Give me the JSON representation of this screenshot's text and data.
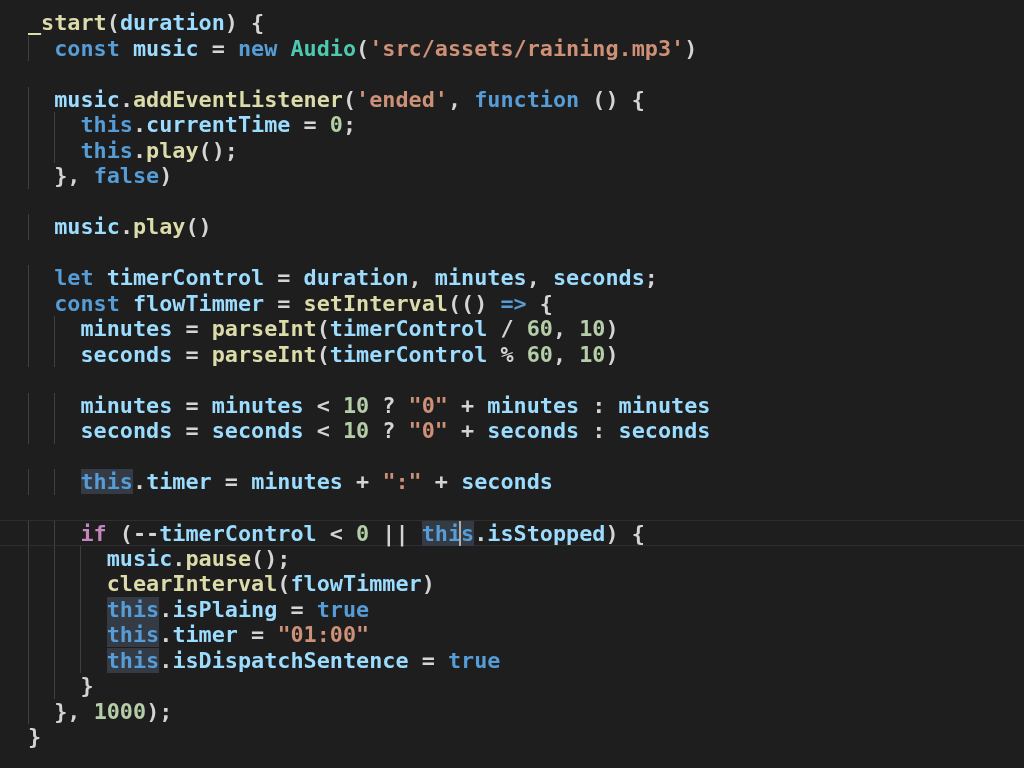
{
  "editor": {
    "lines": [
      {
        "kind": "code",
        "tokens": [
          {
            "text": "_start",
            "kind": "function"
          },
          {
            "text": "(",
            "kind": "punct"
          },
          {
            "text": "duration",
            "kind": "variable"
          },
          {
            "text": ") {",
            "kind": "punct"
          }
        ]
      },
      {
        "kind": "code",
        "tokens": [
          {
            "text": "  const ",
            "kind": "keyword"
          },
          {
            "text": "music",
            "kind": "variable"
          },
          {
            "text": " = ",
            "kind": "punct"
          },
          {
            "text": "new ",
            "kind": "keyword"
          },
          {
            "text": "Audio",
            "kind": "class"
          },
          {
            "text": "(",
            "kind": "punct"
          },
          {
            "text": "'src/assets/raining.mp3'",
            "kind": "string"
          },
          {
            "text": ")",
            "kind": "punct"
          }
        ]
      },
      {
        "kind": "blank"
      },
      {
        "kind": "code",
        "tokens": [
          {
            "text": "  music",
            "kind": "variable"
          },
          {
            "text": ".",
            "kind": "punct"
          },
          {
            "text": "addEventListener",
            "kind": "function"
          },
          {
            "text": "(",
            "kind": "punct"
          },
          {
            "text": "'ended'",
            "kind": "string"
          },
          {
            "text": ", ",
            "kind": "punct"
          },
          {
            "text": "function",
            "kind": "keyword"
          },
          {
            "text": " () {",
            "kind": "punct"
          }
        ]
      },
      {
        "kind": "code",
        "tokens": [
          {
            "text": "    this",
            "kind": "keyword"
          },
          {
            "text": ".",
            "kind": "punct"
          },
          {
            "text": "currentTime",
            "kind": "variable"
          },
          {
            "text": " = ",
            "kind": "punct"
          },
          {
            "text": "0",
            "kind": "number"
          },
          {
            "text": ";",
            "kind": "punct"
          }
        ]
      },
      {
        "kind": "code",
        "tokens": [
          {
            "text": "    this",
            "kind": "keyword"
          },
          {
            "text": ".",
            "kind": "punct"
          },
          {
            "text": "play",
            "kind": "function"
          },
          {
            "text": "();",
            "kind": "punct"
          }
        ]
      },
      {
        "kind": "code",
        "tokens": [
          {
            "text": "  }, ",
            "kind": "punct"
          },
          {
            "text": "false",
            "kind": "keyword"
          },
          {
            "text": ")",
            "kind": "punct"
          }
        ]
      },
      {
        "kind": "blank"
      },
      {
        "kind": "code",
        "tokens": [
          {
            "text": "  music",
            "kind": "variable"
          },
          {
            "text": ".",
            "kind": "punct"
          },
          {
            "text": "play",
            "kind": "function"
          },
          {
            "text": "()",
            "kind": "punct"
          }
        ]
      },
      {
        "kind": "blank"
      },
      {
        "kind": "code",
        "tokens": [
          {
            "text": "  let ",
            "kind": "keyword"
          },
          {
            "text": "timerControl",
            "kind": "variable"
          },
          {
            "text": " = ",
            "kind": "punct"
          },
          {
            "text": "duration",
            "kind": "variable"
          },
          {
            "text": ", ",
            "kind": "punct"
          },
          {
            "text": "minutes",
            "kind": "variable"
          },
          {
            "text": ", ",
            "kind": "punct"
          },
          {
            "text": "seconds",
            "kind": "variable"
          },
          {
            "text": ";",
            "kind": "punct"
          }
        ]
      },
      {
        "kind": "code",
        "tokens": [
          {
            "text": "  const ",
            "kind": "keyword"
          },
          {
            "text": "flowTimmer",
            "kind": "variable"
          },
          {
            "text": " = ",
            "kind": "punct"
          },
          {
            "text": "setInterval",
            "kind": "function"
          },
          {
            "text": "(() ",
            "kind": "punct"
          },
          {
            "text": "=>",
            "kind": "keyword"
          },
          {
            "text": " {",
            "kind": "punct"
          }
        ]
      },
      {
        "kind": "code",
        "tokens": [
          {
            "text": "    minutes",
            "kind": "variable"
          },
          {
            "text": " = ",
            "kind": "punct"
          },
          {
            "text": "parseInt",
            "kind": "function"
          },
          {
            "text": "(",
            "kind": "punct"
          },
          {
            "text": "timerControl",
            "kind": "variable"
          },
          {
            "text": " / ",
            "kind": "punct"
          },
          {
            "text": "60",
            "kind": "number"
          },
          {
            "text": ", ",
            "kind": "punct"
          },
          {
            "text": "10",
            "kind": "number"
          },
          {
            "text": ")",
            "kind": "punct"
          }
        ]
      },
      {
        "kind": "code",
        "tokens": [
          {
            "text": "    seconds",
            "kind": "variable"
          },
          {
            "text": " = ",
            "kind": "punct"
          },
          {
            "text": "parseInt",
            "kind": "function"
          },
          {
            "text": "(",
            "kind": "punct"
          },
          {
            "text": "timerControl",
            "kind": "variable"
          },
          {
            "text": " % ",
            "kind": "punct"
          },
          {
            "text": "60",
            "kind": "number"
          },
          {
            "text": ", ",
            "kind": "punct"
          },
          {
            "text": "10",
            "kind": "number"
          },
          {
            "text": ")",
            "kind": "punct"
          }
        ]
      },
      {
        "kind": "blank"
      },
      {
        "kind": "code",
        "tokens": [
          {
            "text": "    minutes",
            "kind": "variable"
          },
          {
            "text": " = ",
            "kind": "punct"
          },
          {
            "text": "minutes",
            "kind": "variable"
          },
          {
            "text": " < ",
            "kind": "punct"
          },
          {
            "text": "10",
            "kind": "number"
          },
          {
            "text": " ? ",
            "kind": "punct"
          },
          {
            "text": "\"0\"",
            "kind": "string"
          },
          {
            "text": " + ",
            "kind": "punct"
          },
          {
            "text": "minutes",
            "kind": "variable"
          },
          {
            "text": " : ",
            "kind": "punct"
          },
          {
            "text": "minutes",
            "kind": "variable"
          }
        ]
      },
      {
        "kind": "code",
        "tokens": [
          {
            "text": "    seconds",
            "kind": "variable"
          },
          {
            "text": " = ",
            "kind": "punct"
          },
          {
            "text": "seconds",
            "kind": "variable"
          },
          {
            "text": " < ",
            "kind": "punct"
          },
          {
            "text": "10",
            "kind": "number"
          },
          {
            "text": " ? ",
            "kind": "punct"
          },
          {
            "text": "\"0\"",
            "kind": "string"
          },
          {
            "text": " + ",
            "kind": "punct"
          },
          {
            "text": "seconds",
            "kind": "variable"
          },
          {
            "text": " : ",
            "kind": "punct"
          },
          {
            "text": "seconds",
            "kind": "variable"
          }
        ]
      },
      {
        "kind": "blank"
      },
      {
        "kind": "code",
        "tokens": [
          {
            "text": "    this",
            "kind": "keyword",
            "highlighted": true
          },
          {
            "text": ".",
            "kind": "punct"
          },
          {
            "text": "timer",
            "kind": "variable"
          },
          {
            "text": " = ",
            "kind": "punct"
          },
          {
            "text": "minutes",
            "kind": "variable"
          },
          {
            "text": " + ",
            "kind": "punct"
          },
          {
            "text": "\":\"",
            "kind": "string"
          },
          {
            "text": " + ",
            "kind": "punct"
          },
          {
            "text": "seconds",
            "kind": "variable"
          }
        ]
      },
      {
        "kind": "blank"
      },
      {
        "kind": "code",
        "current": true,
        "tokens": [
          {
            "text": "    if",
            "kind": "control"
          },
          {
            "text": " (--",
            "kind": "punct"
          },
          {
            "text": "timerControl",
            "kind": "variable"
          },
          {
            "text": " < ",
            "kind": "punct"
          },
          {
            "text": "0",
            "kind": "number"
          },
          {
            "text": " || ",
            "kind": "punct"
          },
          {
            "text": "thi",
            "kind": "keyword",
            "highlighted": true
          },
          {
            "text": "s",
            "kind": "keyword",
            "highlighted": true,
            "cursor": true
          },
          {
            "text": ".",
            "kind": "punct"
          },
          {
            "text": "isStopped",
            "kind": "variable"
          },
          {
            "text": ") {",
            "kind": "punct"
          }
        ]
      },
      {
        "kind": "code",
        "tokens": [
          {
            "text": "      music",
            "kind": "variable"
          },
          {
            "text": ".",
            "kind": "punct"
          },
          {
            "text": "pause",
            "kind": "function"
          },
          {
            "text": "();",
            "kind": "punct"
          }
        ]
      },
      {
        "kind": "code",
        "tokens": [
          {
            "text": "      clearInterval",
            "kind": "function"
          },
          {
            "text": "(",
            "kind": "punct"
          },
          {
            "text": "flowTimmer",
            "kind": "variable"
          },
          {
            "text": ")",
            "kind": "punct"
          }
        ]
      },
      {
        "kind": "code",
        "tokens": [
          {
            "text": "      this",
            "kind": "keyword",
            "highlighted": true
          },
          {
            "text": ".",
            "kind": "punct"
          },
          {
            "text": "isPlaing",
            "kind": "variable"
          },
          {
            "text": " = ",
            "kind": "punct"
          },
          {
            "text": "true",
            "kind": "keyword"
          }
        ]
      },
      {
        "kind": "code",
        "tokens": [
          {
            "text": "      this",
            "kind": "keyword",
            "highlighted": true
          },
          {
            "text": ".",
            "kind": "punct"
          },
          {
            "text": "timer",
            "kind": "variable"
          },
          {
            "text": " = ",
            "kind": "punct"
          },
          {
            "text": "\"01:00\"",
            "kind": "string"
          }
        ]
      },
      {
        "kind": "code",
        "tokens": [
          {
            "text": "      this",
            "kind": "keyword",
            "highlighted": true
          },
          {
            "text": ".",
            "kind": "punct"
          },
          {
            "text": "isDispatchSentence",
            "kind": "variable"
          },
          {
            "text": " = ",
            "kind": "punct"
          },
          {
            "text": "true",
            "kind": "keyword"
          }
        ]
      },
      {
        "kind": "code",
        "tokens": [
          {
            "text": "    }",
            "kind": "punct"
          }
        ]
      },
      {
        "kind": "code",
        "tokens": [
          {
            "text": "  }, ",
            "kind": "punct"
          },
          {
            "text": "1000",
            "kind": "number"
          },
          {
            "text": ");",
            "kind": "punct"
          }
        ]
      },
      {
        "kind": "code",
        "tokens": [
          {
            "text": "}",
            "kind": "punct"
          }
        ]
      }
    ]
  }
}
